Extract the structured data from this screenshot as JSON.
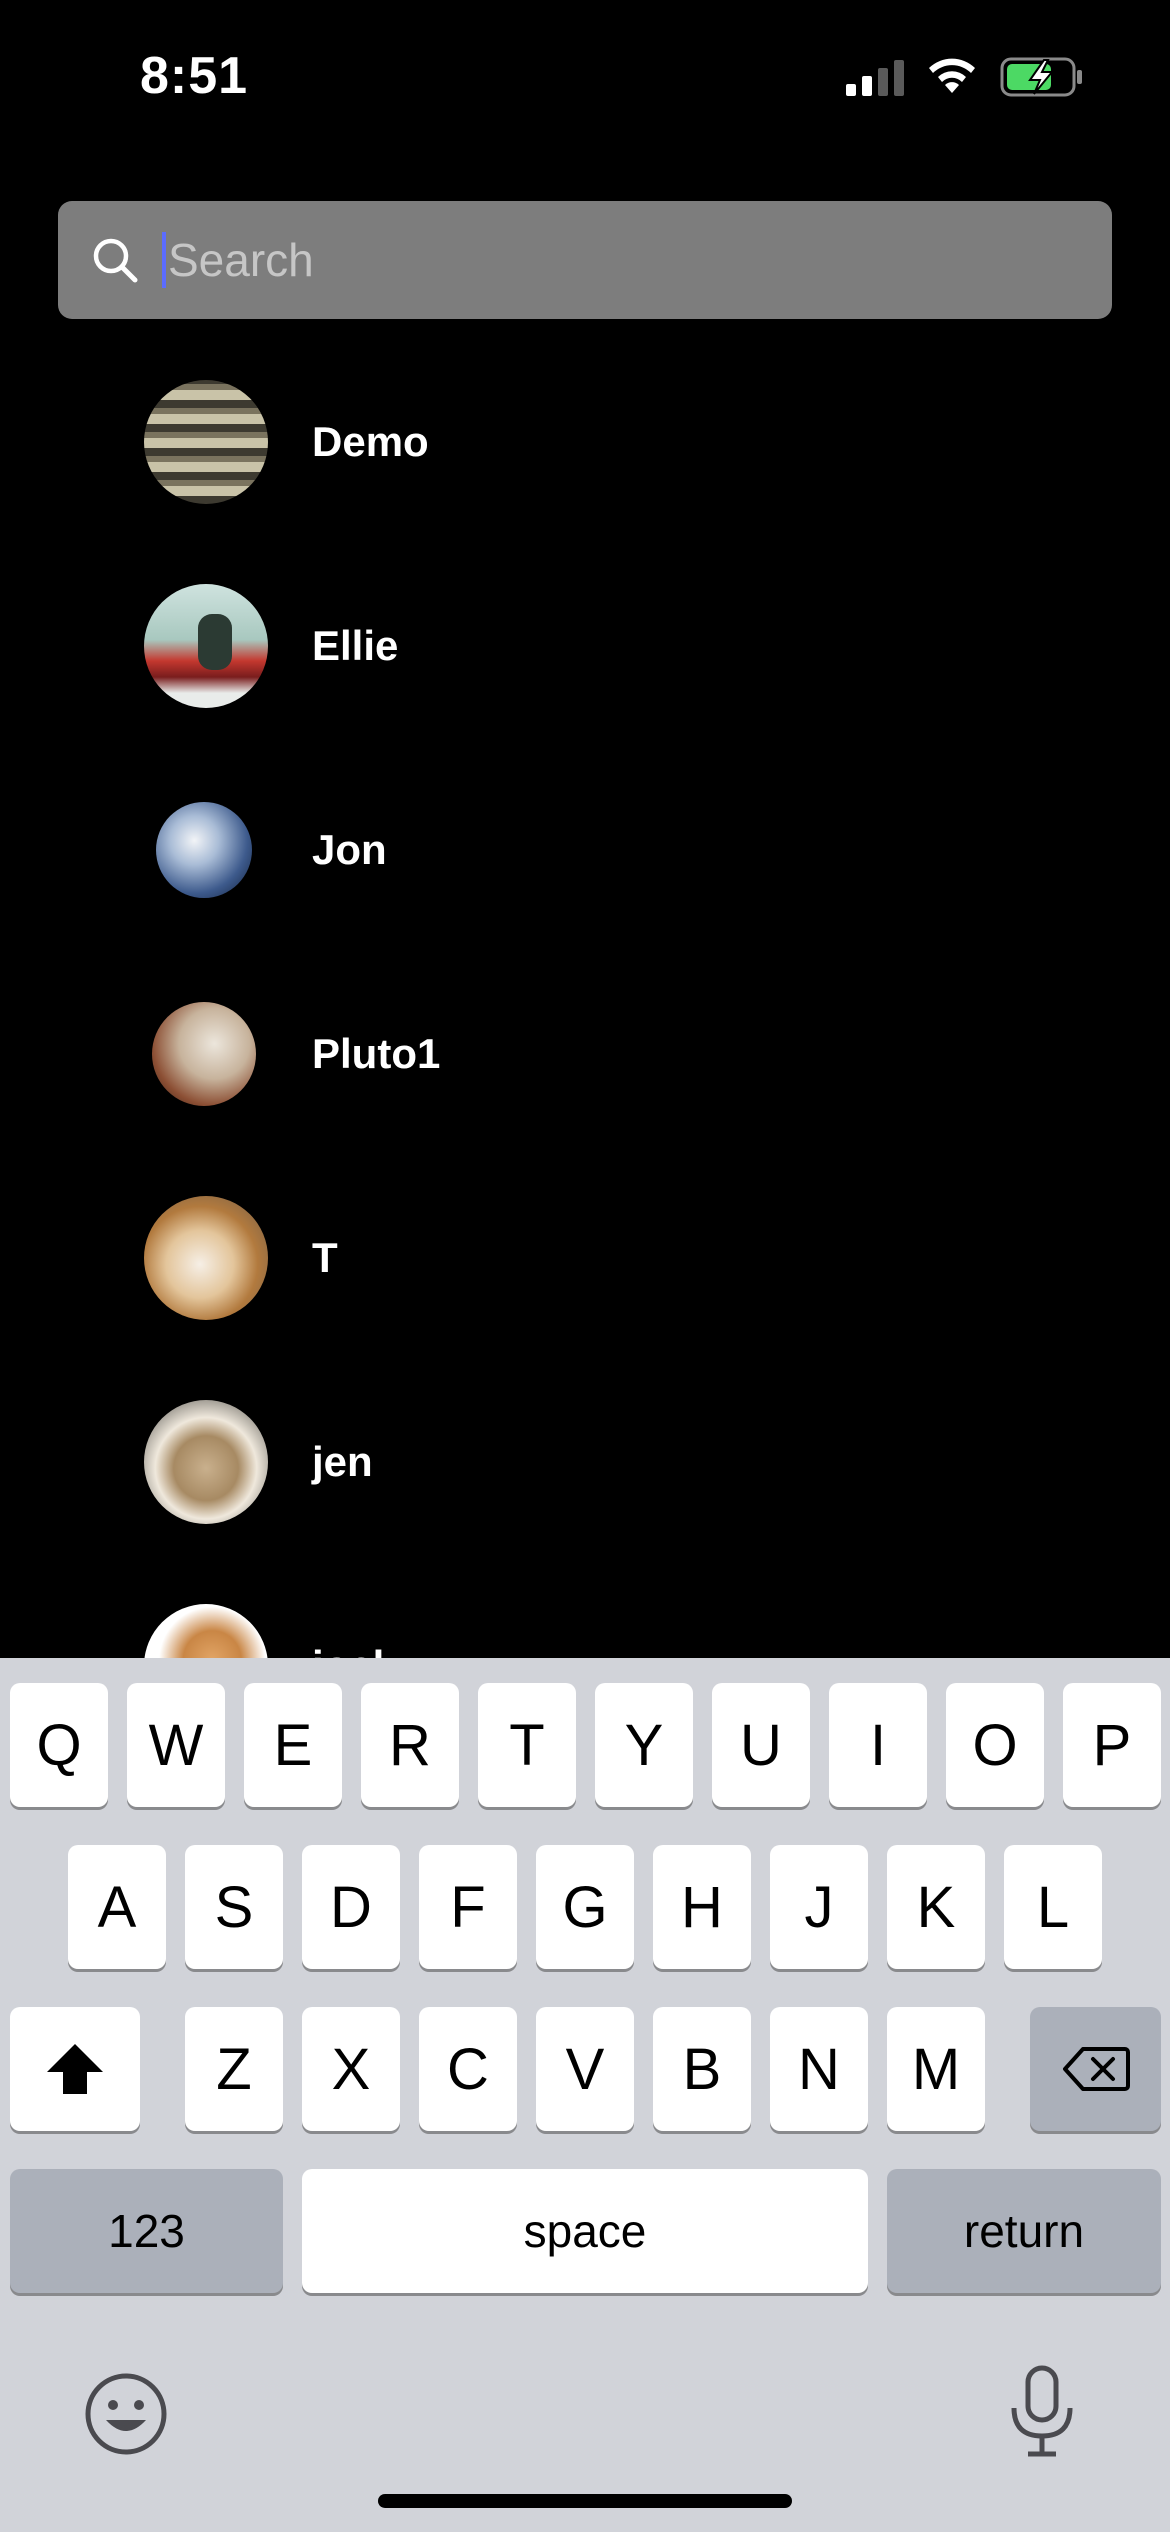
{
  "status": {
    "time": "8:51",
    "battery_color": "#4cd964"
  },
  "search": {
    "placeholder": "Search",
    "value": ""
  },
  "contacts": [
    {
      "name": "Demo",
      "avatar": "pattern-avatar"
    },
    {
      "name": "Ellie",
      "avatar": "kayaker-avatar"
    },
    {
      "name": "Jon",
      "avatar": "earth-avatar"
    },
    {
      "name": "Pluto1",
      "avatar": "pluto-avatar"
    },
    {
      "name": "T",
      "avatar": "dog-avatar"
    },
    {
      "name": "jen",
      "avatar": "cat-in-bowl-avatar"
    },
    {
      "name": "joel",
      "avatar": "cat-avatar"
    }
  ],
  "keyboard": {
    "row1": [
      "Q",
      "W",
      "E",
      "R",
      "T",
      "Y",
      "U",
      "I",
      "O",
      "P"
    ],
    "row2": [
      "A",
      "S",
      "D",
      "F",
      "G",
      "H",
      "J",
      "K",
      "L"
    ],
    "row3": [
      "Z",
      "X",
      "C",
      "V",
      "B",
      "N",
      "M"
    ],
    "numbers_label": "123",
    "space_label": "space",
    "return_label": "return"
  }
}
